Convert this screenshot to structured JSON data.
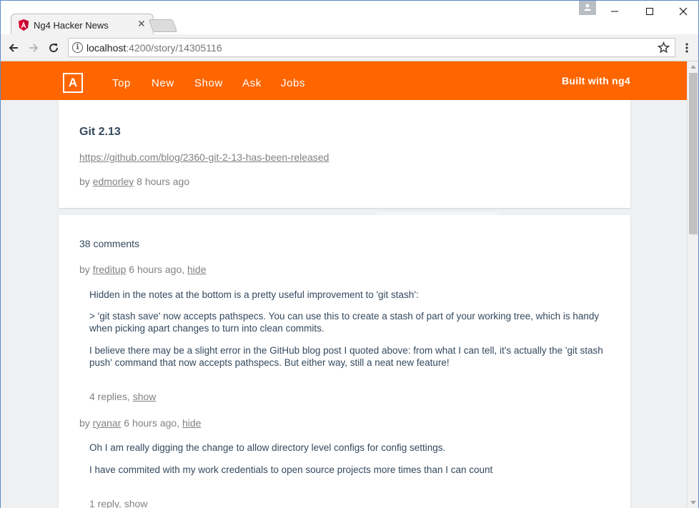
{
  "browser": {
    "tab_title": "Ng4 Hacker News",
    "url_host": "localhost",
    "url_path": ":4200/story/14305116"
  },
  "header": {
    "logo": "A",
    "nav": [
      "Top",
      "New",
      "Show",
      "Ask",
      "Jobs"
    ],
    "built_with": "Built with ng4",
    "color": "#ff6600"
  },
  "story": {
    "title": "Git 2.13",
    "url": "https://github.com/blog/2360-git-2-13-has-been-released",
    "by_prefix": "by",
    "author": "edmorley",
    "time": "8 hours ago"
  },
  "comments": {
    "count_label": "38 comments",
    "items": [
      {
        "by_prefix": "by",
        "author": "freditup",
        "time": "6 hours ago,",
        "hide": "hide",
        "paragraphs": [
          "Hidden in the notes at the bottom is a pretty useful improvement to 'git stash':",
          "> 'git stash save' now accepts pathspecs. You can use this to create a stash of part of your working tree, which is handy when picking apart changes to turn into clean commits.",
          "I believe there may be a slight error in the GitHub blog post I quoted above: from what I can tell, it's actually the 'git stash push' command that now accepts pathspecs. But either way, still a neat new feature!"
        ],
        "replies": "4 replies,",
        "show": "show"
      },
      {
        "by_prefix": "by",
        "author": "ryanar",
        "time": "6 hours ago,",
        "hide": "hide",
        "paragraphs": [
          "Oh I am really digging the change to allow directory level configs for config settings.",
          "I have commited with my work credentials to open source projects more times than I can count"
        ],
        "replies": "1 reply,",
        "show": "show"
      }
    ]
  }
}
